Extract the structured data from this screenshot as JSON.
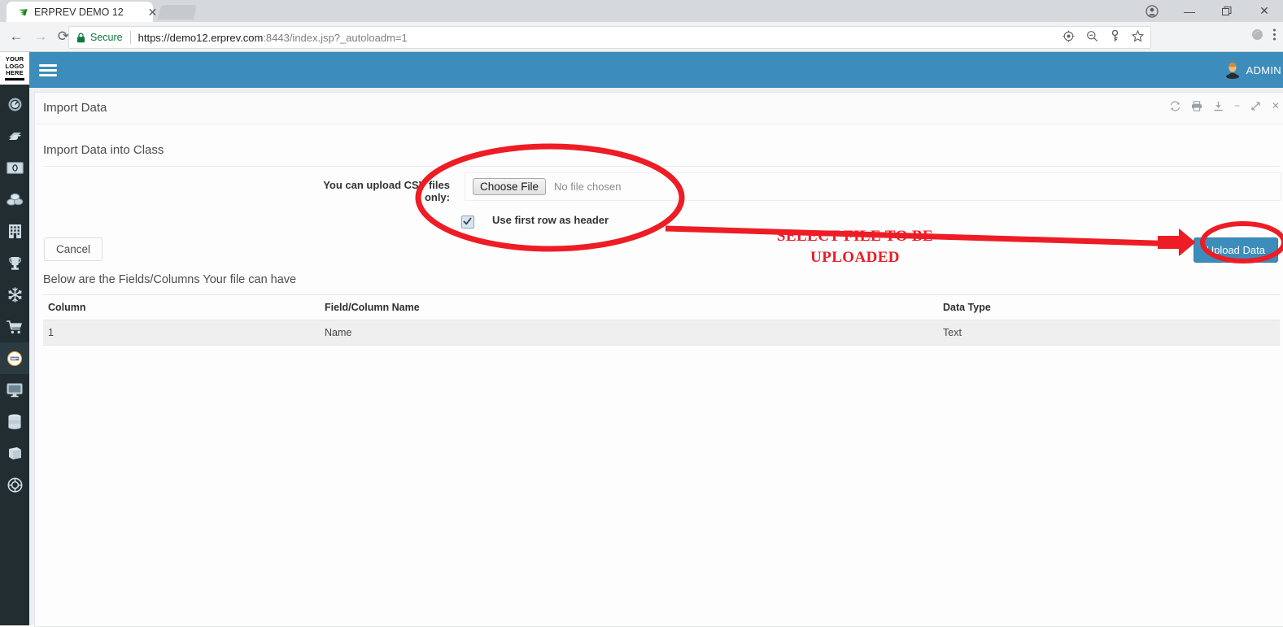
{
  "browser": {
    "tab": {
      "title": "ERPREV DEMO 12",
      "close_label": "✕",
      "favicon": "erprev-logo-icon"
    },
    "window_controls": {
      "profile": "profile-icon",
      "minimize": "—",
      "restore": "❐",
      "close": "✕"
    },
    "nav": {
      "back": "←",
      "forward": "→",
      "reload": "⟳"
    },
    "omnibox": {
      "security_label": "Secure",
      "url_scheme_host": "https://demo12.erprev.com",
      "url_rest": ":8443/index.jsp?_autoloadm=1",
      "icons": [
        "target-icon",
        "zoom-out-icon",
        "key-icon",
        "star-icon"
      ]
    },
    "extensions": [
      "extension-icon",
      "menu-dots-icon"
    ]
  },
  "sidebar": {
    "logo": {
      "line1": "YOUR",
      "line2": "LOGO",
      "line3": "HERE"
    },
    "items": [
      {
        "name": "dashboard",
        "icon": "gauge-icon",
        "active": false
      },
      {
        "name": "tags",
        "icon": "tags-icon",
        "active": false
      },
      {
        "name": "money",
        "icon": "money-bill-icon",
        "active": false
      },
      {
        "name": "coins",
        "icon": "coins-icon",
        "active": false
      },
      {
        "name": "building",
        "icon": "building-icon",
        "active": false
      },
      {
        "name": "trophy",
        "icon": "trophy-icon",
        "active": false
      },
      {
        "name": "snowflake",
        "icon": "snowflake-icon",
        "active": false
      },
      {
        "name": "cart",
        "icon": "shopping-cart-icon",
        "active": false
      },
      {
        "name": "import",
        "icon": "circle-card-icon",
        "active": true
      },
      {
        "name": "desktop",
        "icon": "monitor-icon",
        "active": false
      },
      {
        "name": "database",
        "icon": "database-icon",
        "active": false
      },
      {
        "name": "book",
        "icon": "book-icon",
        "active": false
      },
      {
        "name": "lifebuoy",
        "icon": "lifebuoy-icon",
        "active": false
      }
    ]
  },
  "topbar": {
    "menu_toggle": "hamburger-icon",
    "user": {
      "label": "ADMIN",
      "avatar": "user-avatar-icon"
    },
    "color": "#3c8dbc"
  },
  "panel": {
    "title": "Import Data",
    "tools": [
      {
        "name": "refresh",
        "glyph": "⟳"
      },
      {
        "name": "print",
        "glyph": "⎙"
      },
      {
        "name": "download",
        "glyph": "⤓"
      },
      {
        "name": "minimize",
        "glyph": "−"
      },
      {
        "name": "expand",
        "glyph": "⤡"
      },
      {
        "name": "close",
        "glyph": "✕"
      }
    ]
  },
  "form": {
    "section_title": "Import Data into Class",
    "file_label": "You can upload CSV files only:",
    "choose_file_button": "Choose File",
    "no_file_text": "No file chosen",
    "header_checkbox_label": "Use first row as header",
    "header_checkbox_checked": true,
    "cancel_button": "Cancel",
    "upload_button": "Upload Data"
  },
  "table": {
    "caption": "Below are the Fields/Columns Your file can have",
    "headers": [
      "Column",
      "Field/Column Name",
      "Data Type"
    ],
    "rows": [
      [
        "1",
        "Name",
        "Text"
      ]
    ]
  },
  "annotations": {
    "color": "#ee1c25",
    "callout_line1": "SELECT FILE TO BE",
    "callout_line2": "UPLOADED",
    "shapes": [
      "ellipse-around-file-input",
      "leader-line",
      "arrow-to-upload-button",
      "ellipse-around-upload-button"
    ]
  }
}
